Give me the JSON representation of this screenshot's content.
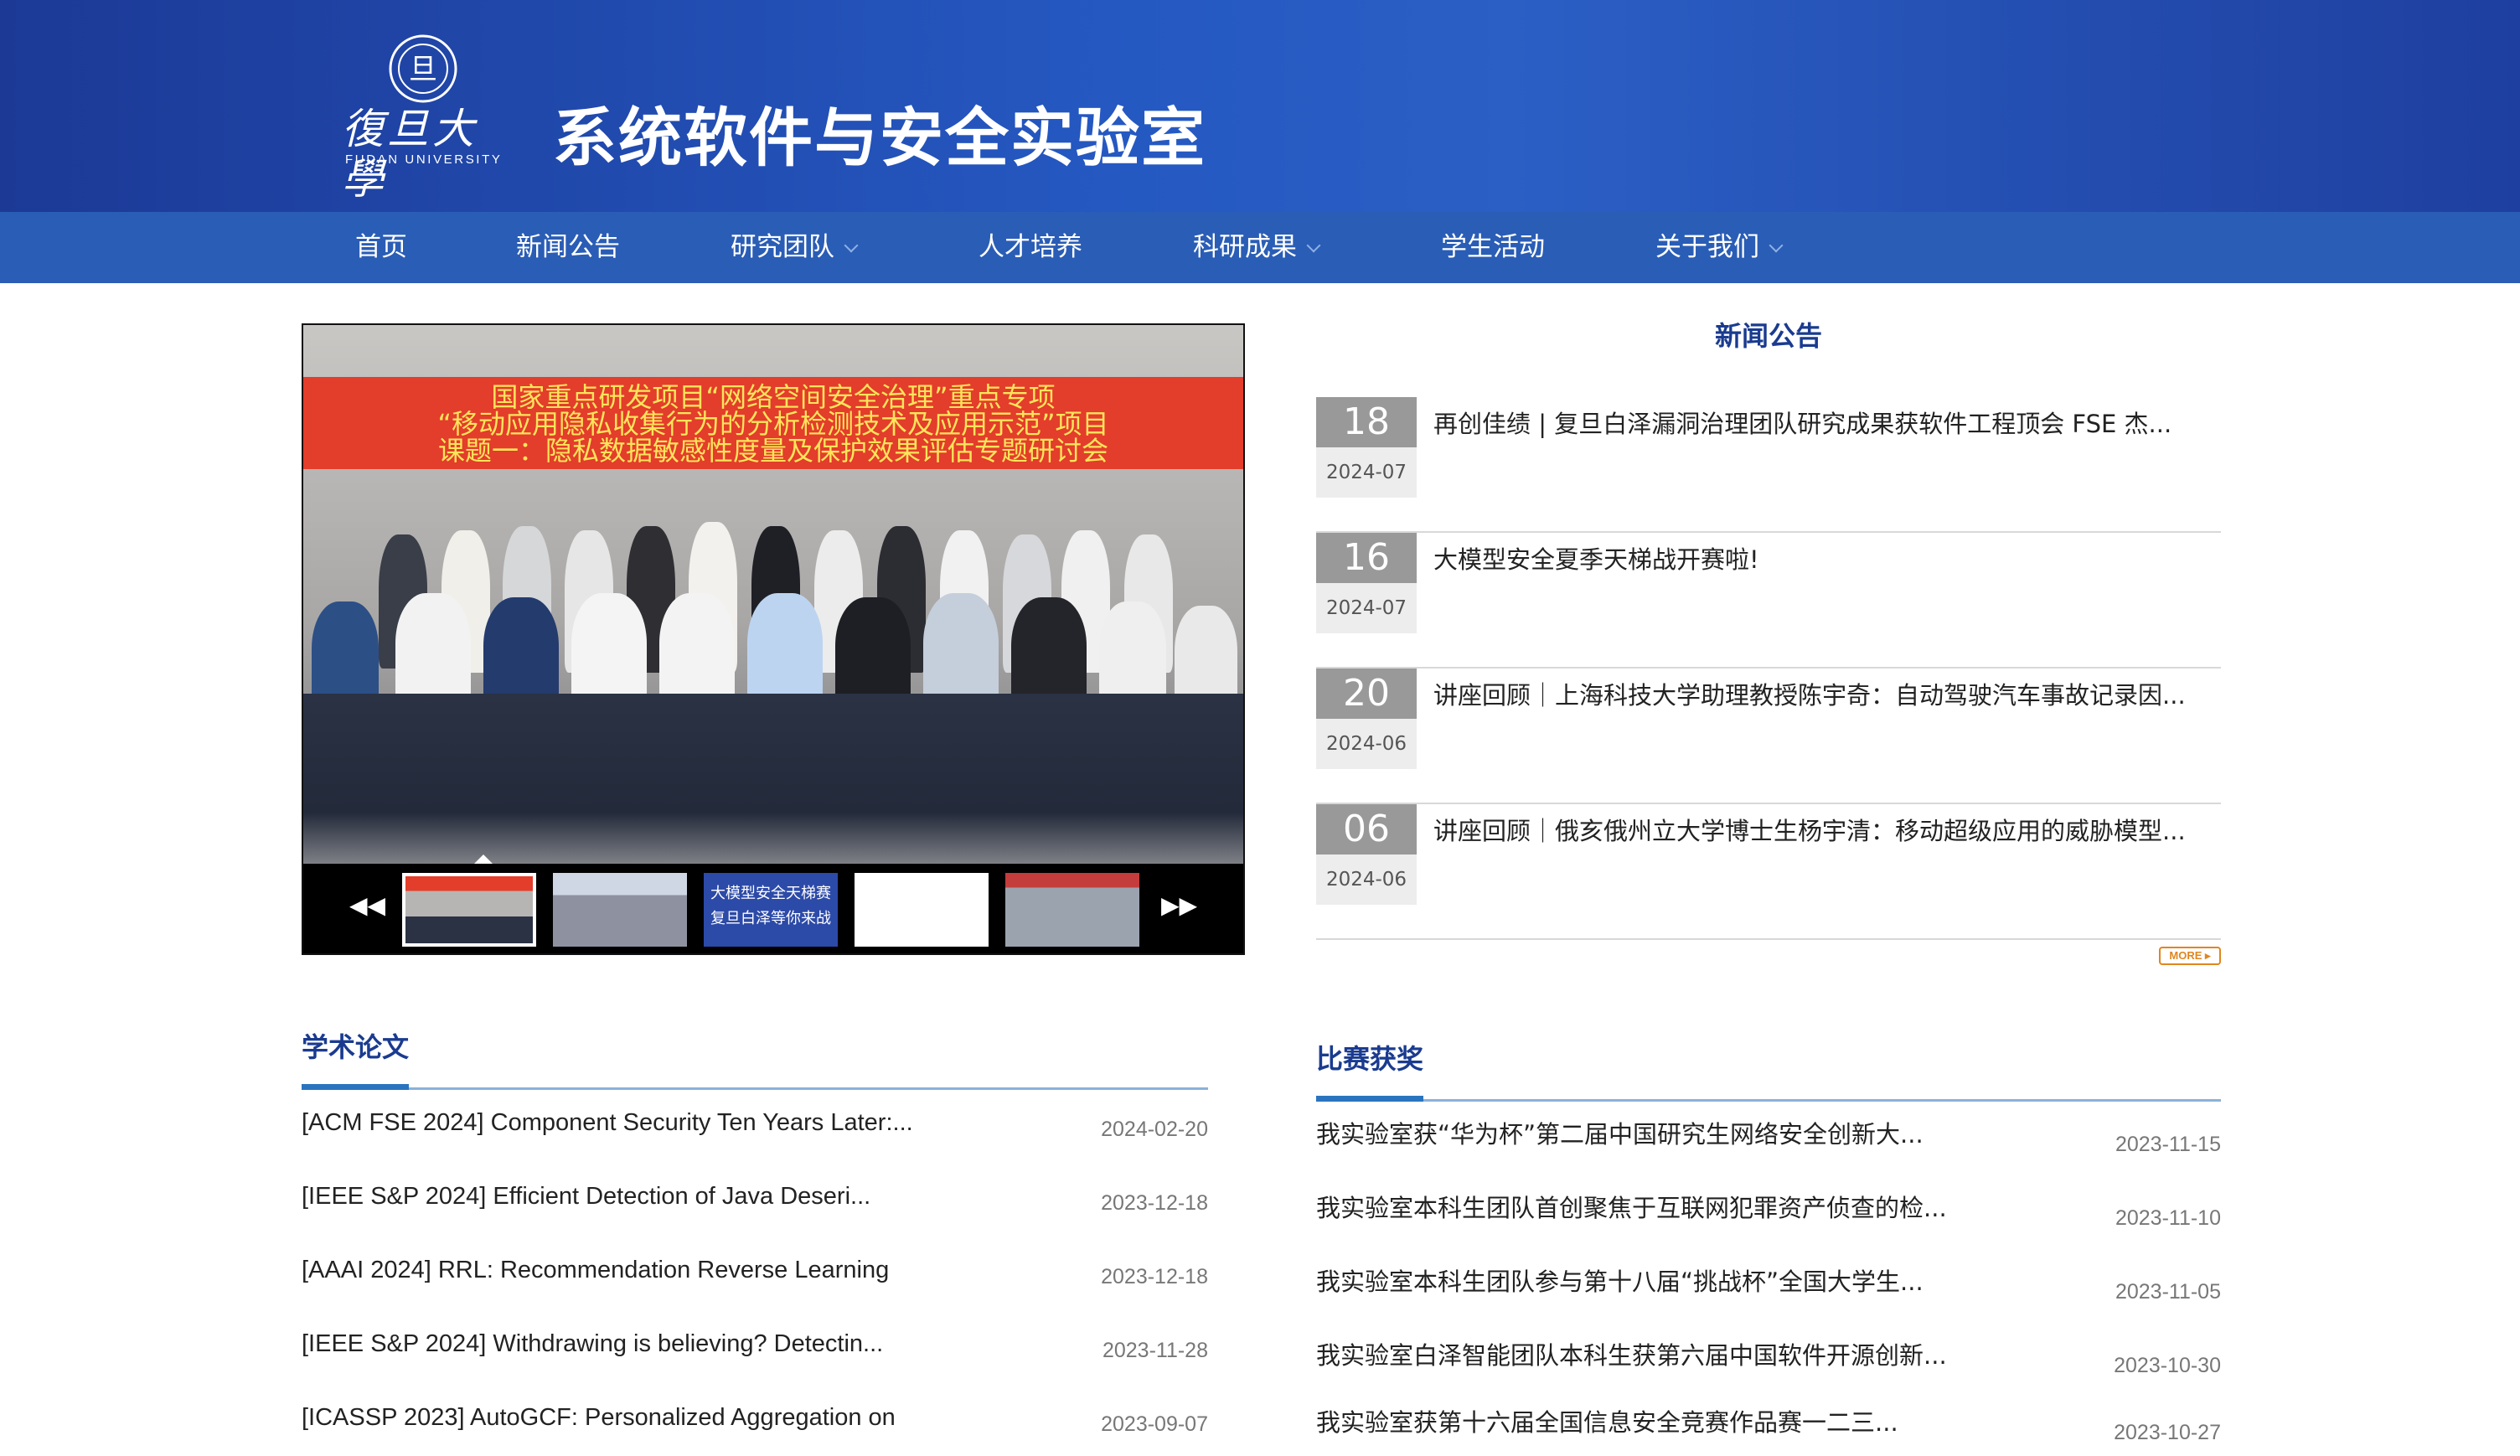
{
  "header": {
    "logo_calligraphy": "復旦大學",
    "logo_en": "FUDAN UNIVERSITY",
    "logo_emblem_text": "旦",
    "title": "系统软件与安全实验室"
  },
  "nav": {
    "items": [
      {
        "label": "首页",
        "dropdown": false
      },
      {
        "label": "新闻公告",
        "dropdown": false
      },
      {
        "label": "研究团队",
        "dropdown": true
      },
      {
        "label": "人才培养",
        "dropdown": false
      },
      {
        "label": "科研成果",
        "dropdown": true
      },
      {
        "label": "学生活动",
        "dropdown": false
      },
      {
        "label": "关于我们",
        "dropdown": true
      }
    ]
  },
  "slideshow": {
    "banner_lines": [
      "国家重点研发项目“网络空间安全治理”重点专项",
      "“移动应用隐私收集行为的分析检测技术及应用示范”项目",
      "课题一：隐私数据敏感性度量及保护效果评估专题研讨会"
    ],
    "thumb3_line1": "大模型安全天梯赛",
    "thumb3_line2": "复旦白泽等你来战",
    "prev_icon": "double-left-arrow",
    "next_icon": "double-right-arrow"
  },
  "news": {
    "heading": "新闻公告",
    "items": [
      {
        "day": "18",
        "ym": "2024-07",
        "title": "再创佳绩 | 复旦白泽漏洞治理团队研究成果获软件工程顶会 FSE 杰..."
      },
      {
        "day": "16",
        "ym": "2024-07",
        "title": "大模型安全夏季天梯战开赛啦!"
      },
      {
        "day": "20",
        "ym": "2024-06",
        "title": "讲座回顾｜上海科技大学助理教授陈宇奇：自动驾驶汽车事故记录因..."
      },
      {
        "day": "06",
        "ym": "2024-06",
        "title": "讲座回顾｜俄亥俄州立大学博士生杨宇清：移动超级应用的威胁模型..."
      }
    ],
    "more_label": "MORE ▸"
  },
  "papers": {
    "heading": "学术论文",
    "items": [
      {
        "title": "[ACM FSE 2024] Component Security Ten Years Later:...",
        "date": "2024-02-20"
      },
      {
        "title": "[IEEE S&P 2024] Efficient Detection of Java Deseri...",
        "date": "2023-12-18"
      },
      {
        "title": "[AAAI 2024] RRL: Recommendation Reverse Learning",
        "date": "2023-12-18"
      },
      {
        "title": "[IEEE S&P 2024] Withdrawing is believing? Detectin...",
        "date": "2023-11-28"
      },
      {
        "title": "[ICASSP 2023] AutoGCF: Personalized Aggregation on",
        "date": "2023-09-07"
      }
    ]
  },
  "awards": {
    "heading": "比赛获奖",
    "items": [
      {
        "title": "我实验室获“华为杯”第二届中国研究生网络安全创新大...",
        "date": "2023-11-15"
      },
      {
        "title": "我实验室本科生团队首创聚焦于互联网犯罪资产侦查的检...",
        "date": "2023-11-10"
      },
      {
        "title": "我实验室本科生团队参与第十八届“挑战杯”全国大学生...",
        "date": "2023-11-05"
      },
      {
        "title": "我实验室白泽智能团队本科生获第六届中国软件开源创新...",
        "date": "2023-10-30"
      },
      {
        "title": "我实验室获第十六届全国信息安全竞赛作品赛一二三...",
        "date": "2023-10-27"
      }
    ]
  },
  "colors": {
    "header_blue": "#2559c2",
    "nav_blue": "#2a5db5",
    "heading_navy": "#1a3b8f",
    "date_gray": "#999999",
    "more_orange": "#e0861f"
  }
}
